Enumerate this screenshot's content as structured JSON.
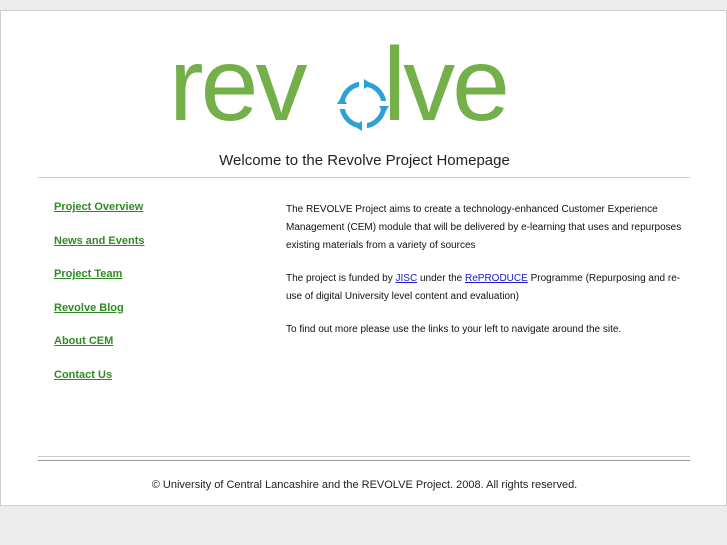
{
  "logo": {
    "text_before_o": "rev",
    "text_after_o": "lve",
    "brand_green": "#74b04a",
    "recycle_blue": "#2f9fd8"
  },
  "welcome": "Welcome to the Revolve Project Homepage",
  "nav": [
    "Project Overview",
    "News and Events",
    "Project Team",
    "Revolve Blog",
    "About CEM",
    "Contact Us"
  ],
  "content": {
    "p1": "The REVOLVE Project aims to create a technology-enhanced Customer Experience Management (CEM) module that will be delivered by e-learning that uses and repurposes existing materials from a variety of sources",
    "p2_before": "The project is funded by ",
    "p2_link1": "JISC",
    "p2_middle": " under the ",
    "p2_link2": "RePRODUCE",
    "p2_after": " Programme (Repurposing and re-use of digital University level content and evaluation)",
    "p3": "To find out more please use the links to your left to navigate around the site."
  },
  "footer": "© University of Central Lancashire and the REVOLVE Project. 2008. All rights reserved."
}
